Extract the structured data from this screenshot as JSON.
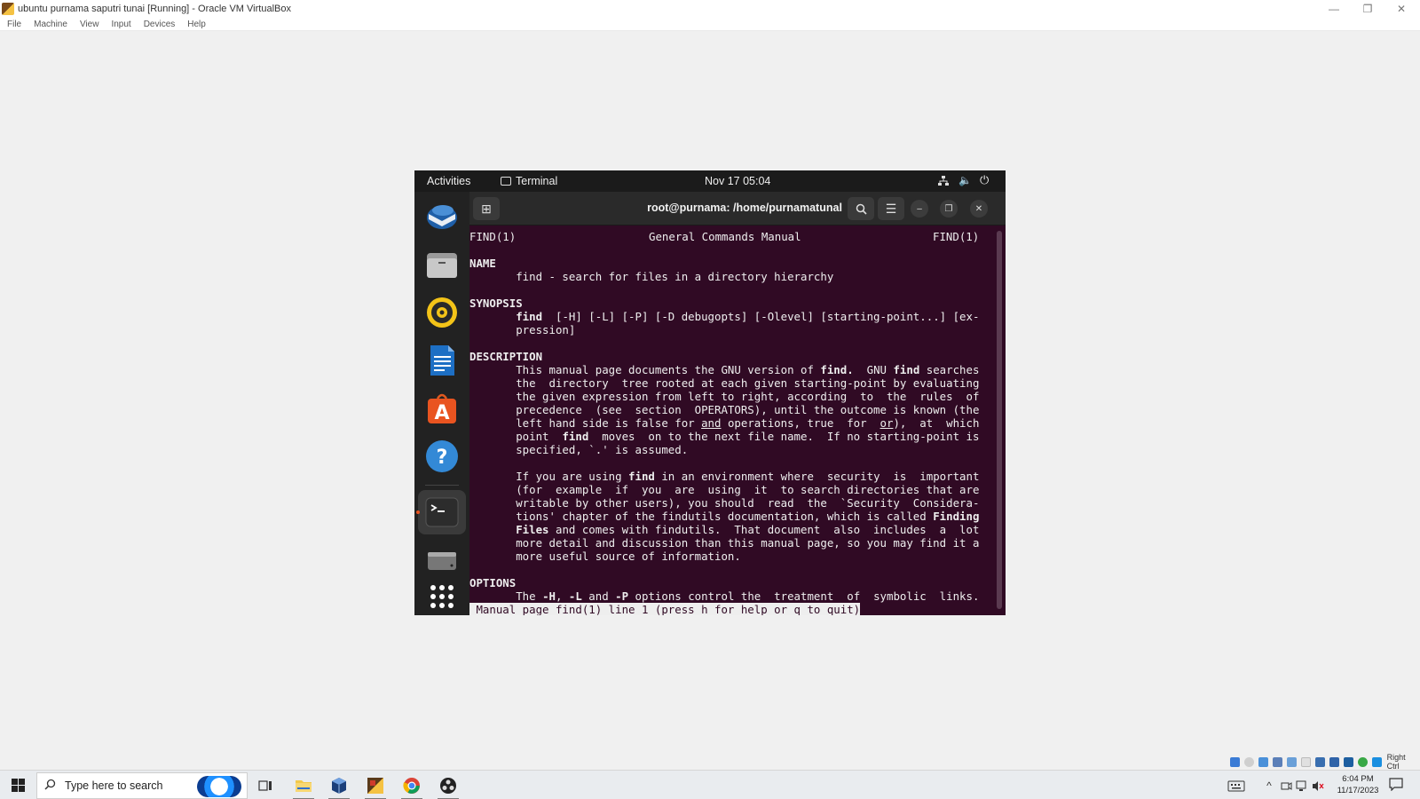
{
  "vbox": {
    "title": "ubuntu purnama saputri tunai [Running] - Oracle VM VirtualBox",
    "menu": [
      "File",
      "Machine",
      "View",
      "Input",
      "Devices",
      "Help"
    ],
    "controls": {
      "minimize": "—",
      "restore": "❐",
      "close": "✕"
    }
  },
  "gnome": {
    "activities": "Activities",
    "app_label": "Terminal",
    "clock": "Nov 17  05:04",
    "volume_icon": "🔈",
    "power_icon": "⏻"
  },
  "dock": {
    "items": [
      "thunderbird",
      "files",
      "rhythmbox",
      "libreoffice-writer",
      "ubuntu-software",
      "help",
      "terminal",
      "disk",
      "show-apps"
    ]
  },
  "terminal": {
    "title": "root@purnama: /home/purnamatunal",
    "new_tab_icon": "⊞",
    "search_icon": "🔍",
    "menu_icon": "☰",
    "min_icon": "–",
    "max_icon": "❐",
    "close_icon": "✕",
    "man": {
      "header_left": "FIND(1)",
      "header_center": "General Commands Manual",
      "header_right": "FIND(1)",
      "name_heading": "NAME",
      "name_line": "       find - search for files in a directory hierarchy",
      "synopsis_heading": "SYNOPSIS",
      "synopsis_cmd": "find",
      "synopsis_rest": "  [-H] [-L] [-P] [-D debugopts] [-Olevel] [starting-point...] [ex-",
      "synopsis_cont": "       pression]",
      "description_heading": "DESCRIPTION",
      "d1_a": "       This manual page documents the GNU version of ",
      "d1_b": "find.",
      "d1_c": "  GNU ",
      "d1_d": "find",
      "d1_e": " searches",
      "d2": "       the  directory  tree rooted at each given starting-point by evaluating",
      "d3": "       the given expression from left to right, according  to  the  rules  of",
      "d4": "       precedence  (see  section  OPERATORS), until the outcome is known (the",
      "d5_a": "       left hand side is false for ",
      "d5_and": "and",
      "d5_b": " operations, true  for  ",
      "d5_or": "or",
      "d5_c": "),  at  which",
      "d6_a": "       point  ",
      "d6_find": "find",
      "d6_b": "  moves  on to the next file name.  If no starting-point is",
      "d7": "       specified, `.' is assumed.",
      "p2_1a": "       If you are using ",
      "p2_1find": "find",
      "p2_1b": " in an environment where  security  is  important",
      "p2_2": "       (for  example  if  you  are  using  it  to search directories that are",
      "p2_3": "       writable by other users), you should  read  the  `Security  Considera-",
      "p2_4a": "       tions' chapter of the findutils documentation, which is called ",
      "p2_4b": "Finding",
      "p2_5a": "       ",
      "p2_5b": "Files",
      "p2_5c": " and comes with findutils.  That document  also  includes  a  lot",
      "p2_6": "       more detail and discussion than this manual page, so you may find it a",
      "p2_7": "       more useful source of information.",
      "options_heading": "OPTIONS",
      "o1_a": "       The ",
      "o1_h": "-H",
      "o1_b": ", ",
      "o1_l": "-L",
      "o1_c": " and ",
      "o1_p": "-P",
      "o1_d": " options control the  treatment  of  symbolic  links.",
      "status": " Manual page find(1) line 1 (press h for help or q to quit)"
    }
  },
  "taskbar": {
    "search_placeholder": "Type here to search",
    "time": "6:04 PM",
    "date": "11/17/2023",
    "host_key": "Right Ctrl",
    "tray_chevron": "^"
  }
}
